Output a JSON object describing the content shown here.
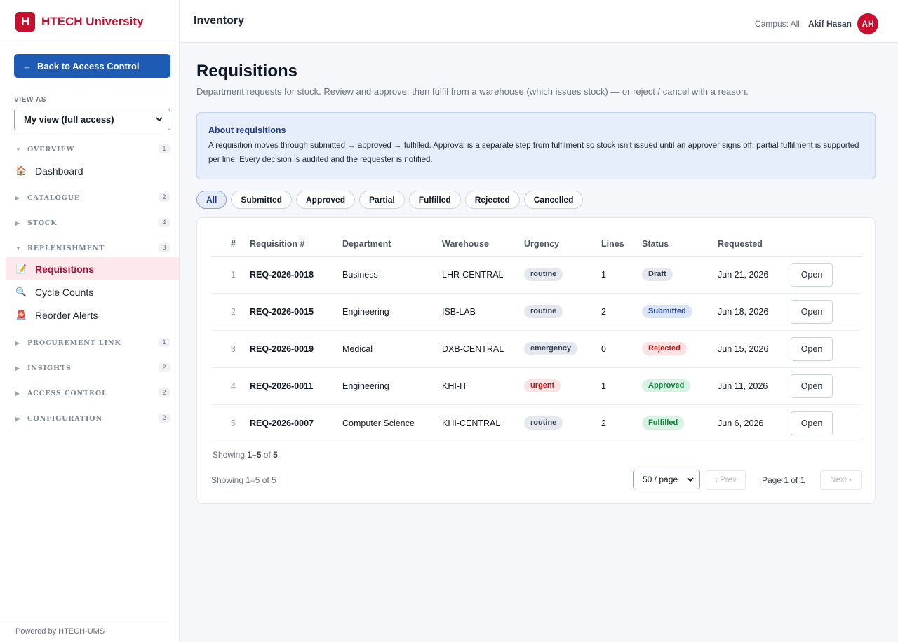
{
  "brand": {
    "logo_letter": "H",
    "name": "HTECH University",
    "color": "#c8102e"
  },
  "sidebar": {
    "back_label": "Back to Access Control",
    "view_as_label": "VIEW AS",
    "view_as_value": "My view (full access)",
    "sections": [
      {
        "label": "OVERVIEW",
        "count": "1",
        "expanded": true
      },
      {
        "label": "CATALOGUE",
        "count": "2",
        "expanded": false
      },
      {
        "label": "STOCK",
        "count": "4",
        "expanded": false
      },
      {
        "label": "REPLENISHMENT",
        "count": "3",
        "expanded": true
      },
      {
        "label": "PROCUREMENT LINK",
        "count": "1",
        "expanded": false
      },
      {
        "label": "INSIGHTS",
        "count": "2",
        "expanded": false
      },
      {
        "label": "ACCESS CONTROL",
        "count": "2",
        "expanded": false
      },
      {
        "label": "CONFIGURATION",
        "count": "2",
        "expanded": false
      }
    ],
    "items": [
      {
        "label": "Dashboard",
        "icon": "house-icon"
      },
      {
        "label": "Requisitions",
        "icon": "memo-icon"
      },
      {
        "label": "Cycle Counts",
        "icon": "magnifier-icon"
      },
      {
        "label": "Reorder Alerts",
        "icon": "siren-icon"
      }
    ],
    "footer": "Powered by HTECH-UMS"
  },
  "topbar": {
    "module_title": "Inventory",
    "campus": "Campus: All",
    "user_name": "Akif Hasan",
    "user_initials": "AH"
  },
  "page": {
    "title": "Requisitions",
    "subtitle": "Department requests for stock. Review and approve, then fulfil from a warehouse (which issues stock) — or reject / cancel with a reason.",
    "info_title": "About requisitions",
    "info_text": "A requisition moves through submitted → approved → fulfilled. Approval is a separate step from fulfilment so stock isn't issued until an approver signs off; partial fulfilment is supported per line. Every decision is audited and the requester is notified."
  },
  "filters": [
    "All",
    "Submitted",
    "Approved",
    "Partial",
    "Fulfilled",
    "Rejected",
    "Cancelled"
  ],
  "active_filter": "All",
  "table": {
    "headers": [
      "#",
      "Requisition #",
      "Department",
      "Warehouse",
      "Urgency",
      "Lines",
      "Status",
      "Requested",
      ""
    ],
    "open_label": "Open",
    "rows": [
      {
        "num": "1",
        "req": "REQ-2026-0018",
        "dept": "Business",
        "wh": "LHR-CENTRAL",
        "urgency": "routine",
        "lines": "1",
        "status": "Draft",
        "date": "Jun 21, 2026"
      },
      {
        "num": "2",
        "req": "REQ-2026-0015",
        "dept": "Engineering",
        "wh": "ISB-LAB",
        "urgency": "routine",
        "lines": "2",
        "status": "Submitted",
        "date": "Jun 18, 2026"
      },
      {
        "num": "3",
        "req": "REQ-2026-0019",
        "dept": "Medical",
        "wh": "DXB-CENTRAL",
        "urgency": "emergency",
        "lines": "0",
        "status": "Rejected",
        "date": "Jun 15, 2026"
      },
      {
        "num": "4",
        "req": "REQ-2026-0011",
        "dept": "Engineering",
        "wh": "KHI-IT",
        "urgency": "urgent",
        "lines": "1",
        "status": "Approved",
        "date": "Jun 11, 2026"
      },
      {
        "num": "5",
        "req": "REQ-2026-0007",
        "dept": "Computer Science",
        "wh": "KHI-CENTRAL",
        "urgency": "routine",
        "lines": "2",
        "status": "Fulfilled",
        "date": "Jun 6, 2026"
      }
    ]
  },
  "pagination": {
    "showing_prefix": "Showing ",
    "showing_range": "1–5",
    "showing_of": " of ",
    "showing_total": "5",
    "showing_text": "Showing 1–5 of 5",
    "per_page": "50 / page",
    "prev": "‹ Prev",
    "page_info": "Page 1 of 1",
    "next": "Next ›"
  }
}
